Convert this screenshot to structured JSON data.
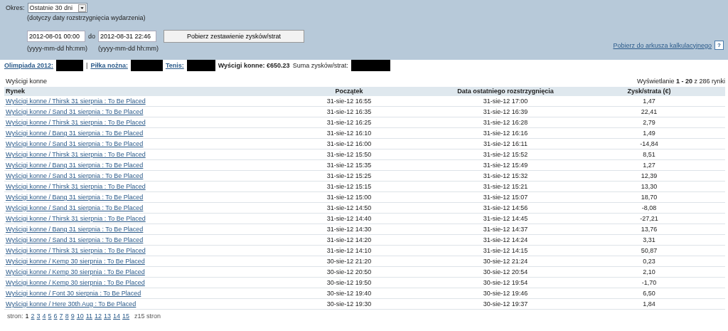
{
  "filter": {
    "period_label": "Okres:",
    "period": "Ostatnie 30 dni",
    "period_note": "(dotyczy daty rozstrzygnięcia wydarzenia)",
    "date_from": "2012-08-01 00:00",
    "date_sep": "do",
    "date_to": "2012-08-31 22:46",
    "from_hint": "(yyyy-mm-dd hh:mm)",
    "to_hint": "(yyyy-mm-dd hh:mm)",
    "submit": "Pobierz zestawienie zysków/strat",
    "export_link": "Pobierz do arkusza kalkulacyjnego",
    "help": "?"
  },
  "summary": [
    {
      "kind": "link",
      "label": "Olimpiada 2012:",
      "redacted": true
    },
    {
      "kind": "separator",
      "label": "|",
      "redacted": false
    },
    {
      "kind": "link",
      "label": "Piłka nożna:",
      "redacted": true
    },
    {
      "kind": "link",
      "label": "Tenis:",
      "redacted": true
    },
    {
      "kind": "total",
      "label": "Wyścigi konne: €650.23",
      "redacted": false
    },
    {
      "kind": "plain",
      "label": "Suma zysków/strat:",
      "redacted": true
    }
  ],
  "section_title": "Wyścigi konne",
  "count": "Wyświetlanie **1 - 20** z 286 rynki",
  "table": {
    "columns": [
      "Rynek",
      "Początek",
      "Data ostatniego rozstrzygnięcia",
      "Zysk/strata (€)"
    ],
    "rows": [
      [
        "Wyścigi konne / Thirsk 31 sierpnia : To Be Placed",
        "31-sie-12 16:55",
        "31-sie-12 17:00",
        "1,47"
      ],
      [
        "Wyścigi konne / Sand 31 sierpnia : To Be Placed",
        "31-sie-12 16:35",
        "31-sie-12 16:39",
        "22,41"
      ],
      [
        "Wyścigi konne / Thirsk 31 sierpnia : To Be Placed",
        "31-sie-12 16:25",
        "31-sie-12 16:28",
        "2,79"
      ],
      [
        "Wyścigi konne / Bang 31 sierpnia : To Be Placed",
        "31-sie-12 16:10",
        "31-sie-12 16:16",
        "1,49"
      ],
      [
        "Wyścigi konne / Sand 31 sierpnia : To Be Placed",
        "31-sie-12 16:00",
        "31-sie-12 16:11",
        "-14,84"
      ],
      [
        "Wyścigi konne / Thirsk 31 sierpnia : To Be Placed",
        "31-sie-12 15:50",
        "31-sie-12 15:52",
        "8,51"
      ],
      [
        "Wyścigi konne / Bang 31 sierpnia : To Be Placed",
        "31-sie-12 15:35",
        "31-sie-12 15:49",
        "1,27"
      ],
      [
        "Wyścigi konne / Sand 31 sierpnia : To Be Placed",
        "31-sie-12 15:25",
        "31-sie-12 15:32",
        "12,39"
      ],
      [
        "Wyścigi konne / Thirsk 31 sierpnia : To Be Placed",
        "31-sie-12 15:15",
        "31-sie-12 15:21",
        "13,30"
      ],
      [
        "Wyścigi konne / Bang 31 sierpnia : To Be Placed",
        "31-sie-12 15:00",
        "31-sie-12 15:07",
        "18,70"
      ],
      [
        "Wyścigi konne / Sand 31 sierpnia : To Be Placed",
        "31-sie-12 14:50",
        "31-sie-12 14:56",
        "-8,08"
      ],
      [
        "Wyścigi konne / Thirsk 31 sierpnia : To Be Placed",
        "31-sie-12 14:40",
        "31-sie-12 14:45",
        "-27,21"
      ],
      [
        "Wyścigi konne / Bang 31 sierpnia : To Be Placed",
        "31-sie-12 14:30",
        "31-sie-12 14:37",
        "13,76"
      ],
      [
        "Wyścigi konne / Sand 31 sierpnia : To Be Placed",
        "31-sie-12 14:20",
        "31-sie-12 14:24",
        "3,31"
      ],
      [
        "Wyścigi konne / Thirsk 31 sierpnia : To Be Placed",
        "31-sie-12 14:10",
        "31-sie-12 14:15",
        "50,87"
      ],
      [
        "Wyścigi konne / Kemp 30 sierpnia : To Be Placed",
        "30-sie-12 21:20",
        "30-sie-12 21:24",
        "0,23"
      ],
      [
        "Wyścigi konne / Kemp 30 sierpnia : To Be Placed",
        "30-sie-12 20:50",
        "30-sie-12 20:54",
        "2,10"
      ],
      [
        "Wyścigi konne / Kemp 30 sierpnia : To Be Placed",
        "30-sie-12 19:50",
        "30-sie-12 19:54",
        "-1,70"
      ],
      [
        "Wyścigi konne / Font 30 sierpnia : To Be Placed",
        "30-sie-12 19:40",
        "30-sie-12 19:46",
        "6,50"
      ],
      [
        "Wyścigi konne / Here 30th Aug : To Be Placed",
        "30-sie-12 19:30",
        "30-sie-12 19:37",
        "1,84"
      ]
    ]
  },
  "pagination": {
    "label": "stron:",
    "pages": [
      {
        "label": "1",
        "selected": true
      },
      {
        "label": "2",
        "selected": false
      },
      {
        "label": "3",
        "selected": false
      },
      {
        "label": "4",
        "selected": false
      },
      {
        "label": "5",
        "selected": false
      },
      {
        "label": "6",
        "selected": false
      },
      {
        "label": "7",
        "selected": false
      },
      {
        "label": "8",
        "selected": false
      },
      {
        "label": "9",
        "selected": false
      },
      {
        "label": "10",
        "selected": false
      },
      {
        "label": "11",
        "selected": false
      },
      {
        "label": "12",
        "selected": false
      },
      {
        "label": "13",
        "selected": false
      },
      {
        "label": "14",
        "selected": false
      },
      {
        "label": "15",
        "selected": false
      }
    ],
    "total": "z15 stron"
  }
}
